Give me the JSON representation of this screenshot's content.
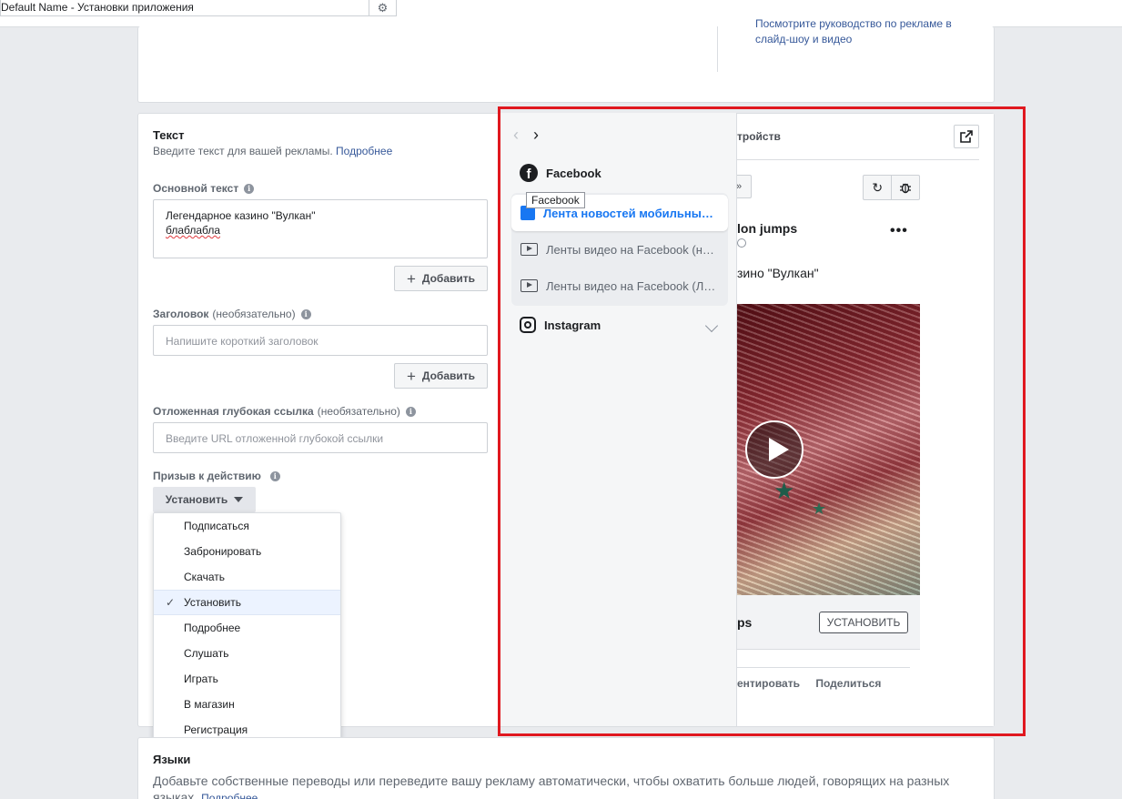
{
  "topbar": {
    "name_field": "Default Name - Установки приложения",
    "settings_icon": "gear-icon"
  },
  "top_card": {
    "link_line1": "Посмотрите руководство по рекламе в",
    "link_line2": "слайд-шоу и видео"
  },
  "text_section": {
    "title": "Текст",
    "description": "Введите текст для вашей рекламы.",
    "learn_more": "Подробнее",
    "primary_text_label": "Основной текст",
    "primary_text_line1": "Легендарное казино \"Вулкан\"",
    "primary_text_line2": "блаблабла",
    "add_label": "Добавить",
    "headline_label": "Заголовок",
    "optional": "(необязательно)",
    "headline_placeholder": "Напишите короткий заголовок",
    "deeplink_label": "Отложенная глубокая ссылка",
    "deeplink_placeholder": "Введите URL отложенной глубокой ссылки",
    "cta_label": "Призыв к действию",
    "cta_selected": "Установить"
  },
  "cta_options": [
    {
      "label": "Подписаться",
      "selected": false
    },
    {
      "label": "Забронировать",
      "selected": false
    },
    {
      "label": "Скачать",
      "selected": false
    },
    {
      "label": "Установить",
      "selected": true
    },
    {
      "label": "Подробнее",
      "selected": false
    },
    {
      "label": "Слушать",
      "selected": false
    },
    {
      "label": "Играть",
      "selected": false
    },
    {
      "label": "В магазин",
      "selected": false
    },
    {
      "label": "Регистрация",
      "selected": false
    }
  ],
  "placements": {
    "facebook": "Facebook",
    "tooltip": "Facebook",
    "items": [
      {
        "label": "Лента новостей мобильных устройств",
        "active": true
      },
      {
        "label": "Ленты видео на Facebook (на мобильных устройствах)",
        "active": false
      },
      {
        "label": "Ленты видео на Facebook (Лента)",
        "active": false
      }
    ],
    "instagram": "Instagram"
  },
  "preview": {
    "title_fragment": "тройств",
    "page_name_fragment": "lon jumps",
    "text_fragment": "зино \"Вулкан\"",
    "app_name_fragment": "ps",
    "install_button": "УСТАНОВИТЬ",
    "comment_fragment": "ентировать",
    "share": "Поделиться",
    "chip_glyph": "»"
  },
  "languages": {
    "title": "Языки",
    "description_line1": "Добавьте собственные переводы или переведите вашу рекламу автоматически, чтобы охватить больше людей, говорящих на разных",
    "description_line2": "языках.",
    "learn_more": "Подробнее"
  },
  "colors": {
    "accent_blue": "#1877f2",
    "link_blue": "#365899",
    "highlight_red": "#e0181f"
  }
}
